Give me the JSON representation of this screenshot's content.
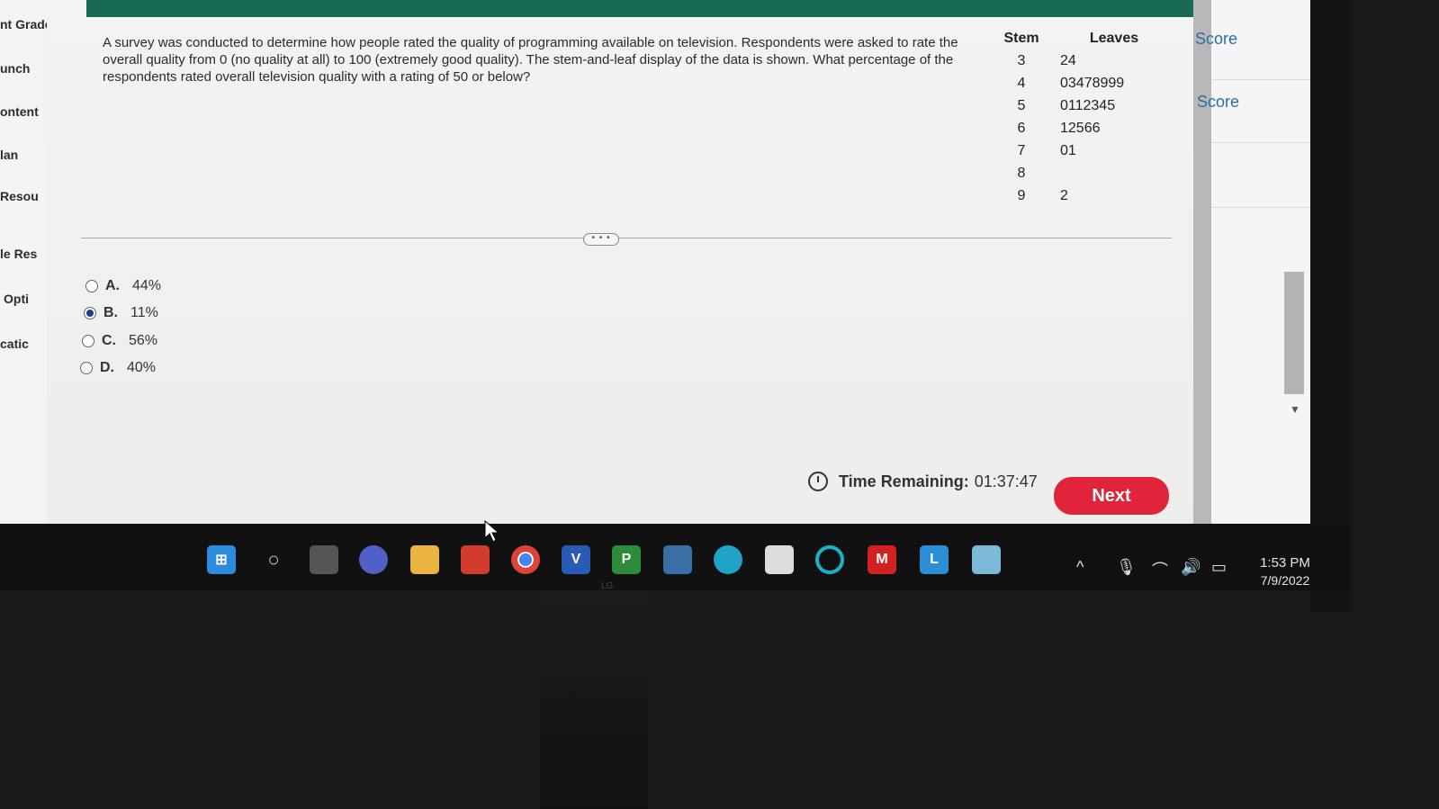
{
  "sidebar": {
    "items": [
      "nt Grade",
      "unch",
      "ontent",
      "lan",
      "Resou",
      "le Res",
      "Opti",
      "catic"
    ]
  },
  "question": {
    "text": "A survey was conducted to determine how people rated the quality of programming available on television. Respondents were asked to rate the overall quality from 0 (no quality at all) to 100 (extremely good quality). The stem-and-leaf display of the data is shown. What percentage of the respondents rated overall television quality with a rating of 50 or below?"
  },
  "stem_leaf": {
    "headers": {
      "stem": "Stem",
      "leaves": "Leaves"
    },
    "rows": [
      {
        "stem": "3",
        "leaves": "24"
      },
      {
        "stem": "4",
        "leaves": "03478999"
      },
      {
        "stem": "5",
        "leaves": "0112345"
      },
      {
        "stem": "6",
        "leaves": "12566"
      },
      {
        "stem": "7",
        "leaves": "01"
      },
      {
        "stem": "8",
        "leaves": ""
      },
      {
        "stem": "9",
        "leaves": "2"
      }
    ]
  },
  "divider_handle": "• • •",
  "options": [
    {
      "letter": "A.",
      "value": "44%",
      "selected": false
    },
    {
      "letter": "B.",
      "value": "11%",
      "selected": true
    },
    {
      "letter": "C.",
      "value": "56%",
      "selected": false
    },
    {
      "letter": "D.",
      "value": "40%",
      "selected": false
    }
  ],
  "timer": {
    "label": "Time Remaining:",
    "value": "01:37:47"
  },
  "next_label": "Next",
  "right_panel": {
    "score_1": "Score",
    "score_2": "Score"
  },
  "taskbar": {
    "time": "1:53 PM",
    "date": "7/9/2022",
    "brand": "LG",
    "icons": [
      "windows-start-icon",
      "search-icon",
      "task-view-icon",
      "zoom-icon",
      "file-explorer-icon",
      "office-icon",
      "chrome-icon",
      "visio-icon",
      "project-icon",
      "app-icon",
      "edge-icon",
      "store-icon",
      "cortana-icon",
      "mcafee-icon",
      "app-l-icon",
      "app-icon-2"
    ]
  },
  "colors": {
    "topbar": "#186a52",
    "next_button": "#e0243a",
    "score_link": "#2a6fa3"
  }
}
